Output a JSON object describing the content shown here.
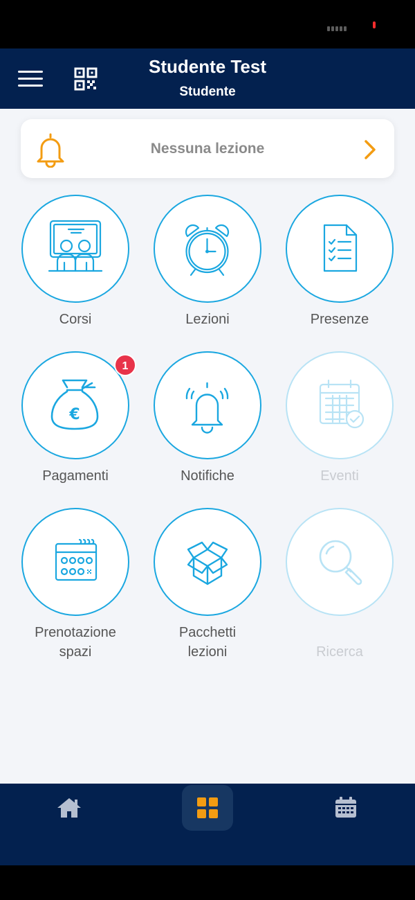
{
  "header": {
    "title": "Studente Test",
    "subtitle": "Studente"
  },
  "lesson_card": {
    "text": "Nessuna lezione"
  },
  "tiles": [
    {
      "label": "Corsi",
      "icon": "classroom-icon"
    },
    {
      "label": "Lezioni",
      "icon": "alarm-clock-icon"
    },
    {
      "label": "Presenze",
      "icon": "checklist-icon"
    },
    {
      "label": "Pagamenti",
      "icon": "money-bag-icon",
      "badge": "1"
    },
    {
      "label": "Notifiche",
      "icon": "bell-icon"
    },
    {
      "label": "Eventi",
      "icon": "calendar-check-icon",
      "disabled": true
    },
    {
      "label": "Prenotazione spazi",
      "line1": "Prenotazione",
      "line2": "spazi",
      "icon": "booking-calendar-icon"
    },
    {
      "label": "Pacchetti lezioni",
      "line1": "Pacchetti",
      "line2": "lezioni",
      "icon": "package-box-icon"
    },
    {
      "label": "Ricerca",
      "icon": "search-icon",
      "disabled": true
    }
  ],
  "bottom_nav": {
    "items": [
      {
        "icon": "home-icon"
      },
      {
        "icon": "grid-icon",
        "active": true
      },
      {
        "icon": "calendar-icon"
      }
    ]
  },
  "colors": {
    "header": "#03214f",
    "accent": "#1aa7e0",
    "warning": "#f39c12",
    "badge": "#e8334a",
    "background": "#f3f5f9"
  }
}
